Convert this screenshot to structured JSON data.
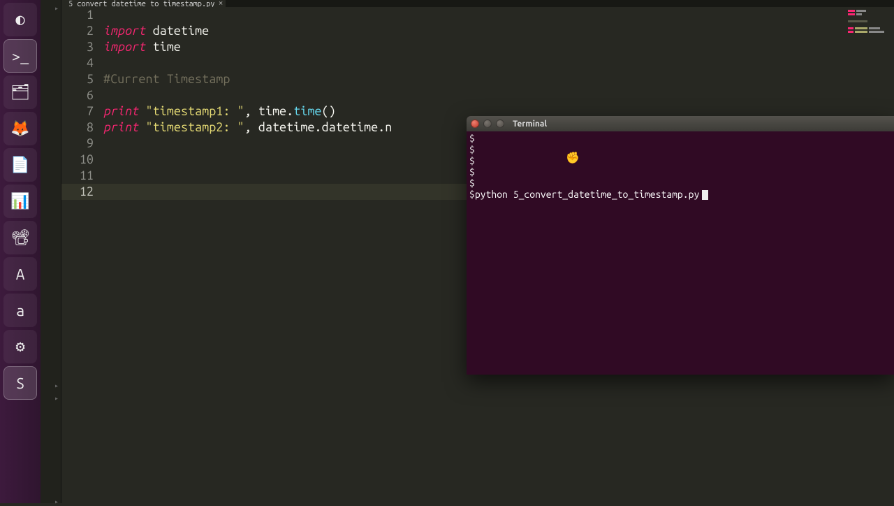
{
  "launcher": {
    "items": [
      {
        "name": "dash-icon",
        "glyph": "◐",
        "active": false
      },
      {
        "name": "terminal-icon",
        "glyph": ">_",
        "active": true
      },
      {
        "name": "files-icon",
        "glyph": "🗂",
        "active": false
      },
      {
        "name": "firefox-icon",
        "glyph": "🦊",
        "active": false
      },
      {
        "name": "writer-icon",
        "glyph": "📄",
        "active": false
      },
      {
        "name": "calc-icon",
        "glyph": "📊",
        "active": false
      },
      {
        "name": "impress-icon",
        "glyph": "📽",
        "active": false
      },
      {
        "name": "software-icon",
        "glyph": "A",
        "active": false
      },
      {
        "name": "amazon-icon",
        "glyph": "a",
        "active": false
      },
      {
        "name": "settings-icon",
        "glyph": "⚙",
        "active": false
      },
      {
        "name": "sublime-icon",
        "glyph": "S",
        "active": true
      }
    ]
  },
  "tab": {
    "filename": "5_convert_datetime_to_timestamp.py"
  },
  "code": {
    "lines": [
      {
        "n": 1,
        "seg": [
          {
            "c": "txt",
            "t": ""
          }
        ]
      },
      {
        "n": 2,
        "seg": [
          {
            "c": "kw",
            "t": "import"
          },
          {
            "c": "txt",
            "t": " datetime"
          }
        ]
      },
      {
        "n": 3,
        "seg": [
          {
            "c": "kw",
            "t": "import"
          },
          {
            "c": "txt",
            "t": " time"
          }
        ]
      },
      {
        "n": 4,
        "seg": [
          {
            "c": "txt",
            "t": ""
          }
        ]
      },
      {
        "n": 5,
        "seg": [
          {
            "c": "cmt",
            "t": "#Current Timestamp"
          }
        ]
      },
      {
        "n": 6,
        "seg": [
          {
            "c": "txt",
            "t": ""
          }
        ]
      },
      {
        "n": 7,
        "seg": [
          {
            "c": "kw",
            "t": "print"
          },
          {
            "c": "txt",
            "t": " "
          },
          {
            "c": "str",
            "t": "\"timestamp1: \""
          },
          {
            "c": "txt",
            "t": ", time."
          },
          {
            "c": "fn",
            "t": "time"
          },
          {
            "c": "txt",
            "t": "()"
          }
        ]
      },
      {
        "n": 8,
        "seg": [
          {
            "c": "kw",
            "t": "print"
          },
          {
            "c": "txt",
            "t": " "
          },
          {
            "c": "str",
            "t": "\"timestamp2: \""
          },
          {
            "c": "txt",
            "t": ", datetime.datetime.n"
          }
        ]
      },
      {
        "n": 9,
        "seg": [
          {
            "c": "txt",
            "t": ""
          }
        ]
      },
      {
        "n": 10,
        "seg": [
          {
            "c": "txt",
            "t": ""
          }
        ]
      },
      {
        "n": 11,
        "seg": [
          {
            "c": "txt",
            "t": ""
          }
        ]
      },
      {
        "n": 12,
        "seg": [
          {
            "c": "txt",
            "t": ""
          }
        ]
      }
    ],
    "active_line": 12
  },
  "terminal": {
    "title": "Terminal",
    "prompt": "$",
    "lines": [
      "$",
      "$",
      "$",
      "$",
      "$"
    ],
    "command": "python 5_convert_datetime_to_timestamp.py"
  }
}
